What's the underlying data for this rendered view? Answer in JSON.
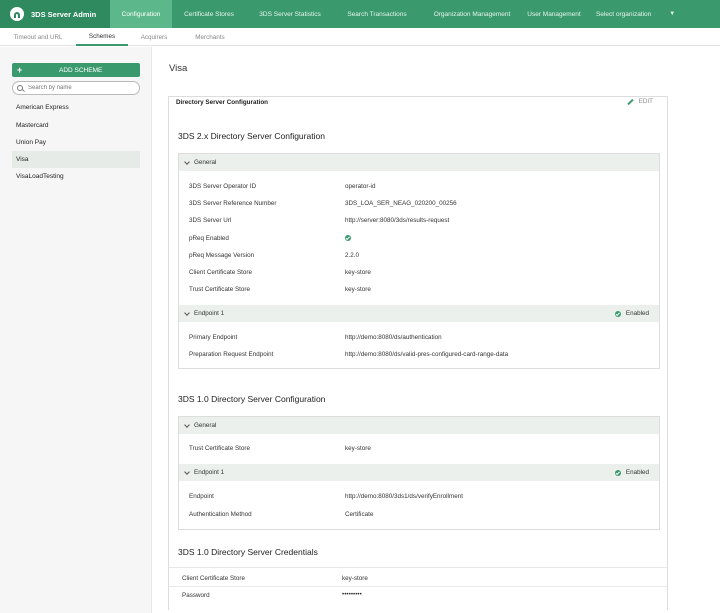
{
  "app": {
    "title": "3DS Server Admin"
  },
  "nav": {
    "items": [
      "Configuration",
      "Certificate Stores",
      "3DS Server Statistics",
      "Search Transactions",
      "Organization Management",
      "User Management"
    ],
    "org_select": "Select organization"
  },
  "subtabs": [
    "Timeout and URL",
    "Schemes",
    "Acquirers",
    "Merchants"
  ],
  "sidebar": {
    "add_label": "ADD SCHEME",
    "search_placeholder": "Search by name",
    "items": [
      "American Express",
      "Mastercard",
      "Union Pay",
      "Visa",
      "VisaLoadTesting"
    ],
    "selected": "Visa"
  },
  "main": {
    "page_title": "Visa",
    "card_title": "Directory Server Configuration",
    "edit_label": "EDIT",
    "ds2": {
      "title": "3DS 2.x Directory Server Configuration",
      "general_label": "General",
      "rows": [
        {
          "label": "3DS Server Operator ID",
          "value": "operator-id"
        },
        {
          "label": "3DS Server Reference Number",
          "value": "3DS_LOA_SER_NEAG_020200_00256"
        },
        {
          "label": "3DS Server Url",
          "value": "http://server:8080/3ds/results-request"
        },
        {
          "label": "pReq Enabled",
          "value": ""
        },
        {
          "label": "pReq Message Version",
          "value": "2.2.0"
        },
        {
          "label": "Client Certificate Store",
          "value": "key-store"
        },
        {
          "label": "Trust Certificate Store",
          "value": "key-store"
        }
      ],
      "endpoint_label": "Endpoint 1",
      "endpoint_status": "Enabled",
      "endpoint_rows": [
        {
          "label": "Primary Endpoint",
          "value": "http://demo:8080/ds/authentication"
        },
        {
          "label": "Preparation Request Endpoint",
          "value": "http://demo:8080/ds/valid-pres-configured-card-range-data"
        }
      ]
    },
    "ds1": {
      "title": "3DS 1.0 Directory Server Configuration",
      "general_label": "General",
      "rows": [
        {
          "label": "Trust Certificate Store",
          "value": "key-store"
        }
      ],
      "endpoint_label": "Endpoint 1",
      "endpoint_status": "Enabled",
      "endpoint_rows": [
        {
          "label": "Endpoint",
          "value": "http://demo:8080/3ds1/ds/verifyEnrollment"
        },
        {
          "label": "Authentication Method",
          "value": "Certificate"
        }
      ]
    },
    "credentials": {
      "title": "3DS 1.0 Directory Server Credentials",
      "rows": [
        {
          "label": "Client Certificate Store",
          "value": "key-store"
        },
        {
          "label": "Password",
          "value": "•••••••••"
        }
      ]
    }
  },
  "colors": {
    "brand": "#3a9a6e",
    "brand_dark": "#2f8a60",
    "nav_active": "#5cb88a",
    "panel_bar": "#ebf0ed"
  }
}
